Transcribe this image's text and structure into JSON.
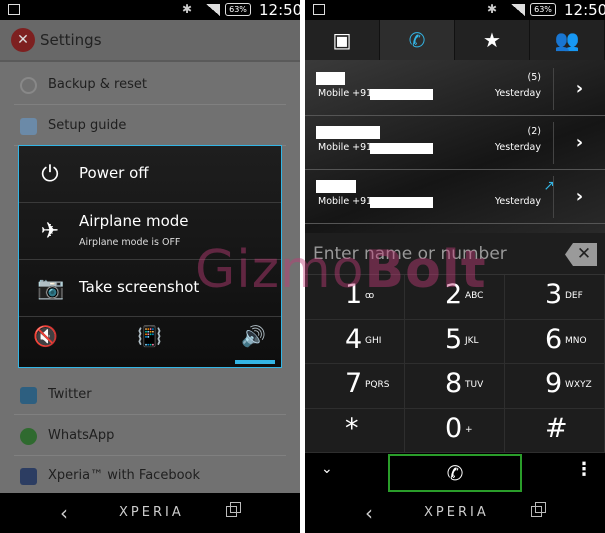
{
  "status": {
    "battery": "63%",
    "time": "12:50"
  },
  "settings": {
    "title": "Settings",
    "items": [
      {
        "label": "Backup & reset"
      },
      {
        "label": "Setup guide"
      },
      {
        "label": "Twitter"
      },
      {
        "label": "WhatsApp"
      },
      {
        "label": "Xperia™ with Facebook"
      }
    ]
  },
  "power_menu": {
    "power_off": "Power off",
    "airplane": "Airplane mode",
    "airplane_status": "Airplane mode is OFF",
    "screenshot": "Take screenshot",
    "sound_mode_selected": "sound-on"
  },
  "nav": {
    "brand": "XPERIA"
  },
  "dialer": {
    "tabs": [
      {
        "icon": "contacts-icon"
      },
      {
        "icon": "phone-icon",
        "selected": true
      },
      {
        "icon": "star-icon"
      },
      {
        "icon": "groups-icon"
      }
    ],
    "calls": [
      {
        "number_prefix": "Mobile +91",
        "count": "(5)",
        "date": "Yesterday"
      },
      {
        "number_prefix": "Mobile +91",
        "count": "(2)",
        "date": "Yesterday"
      },
      {
        "number_prefix": "Mobile +91",
        "date": "Yesterday",
        "type": "outgoing"
      }
    ],
    "input_placeholder": "Enter name or number",
    "keys": [
      {
        "d": "1",
        "l": "ꝏ"
      },
      {
        "d": "2",
        "l": "ABC"
      },
      {
        "d": "3",
        "l": "DEF"
      },
      {
        "d": "4",
        "l": "GHI"
      },
      {
        "d": "5",
        "l": "JKL"
      },
      {
        "d": "6",
        "l": "MNO"
      },
      {
        "d": "7",
        "l": "PQRS"
      },
      {
        "d": "8",
        "l": "TUV"
      },
      {
        "d": "9",
        "l": "WXYZ"
      },
      {
        "d": "*",
        "l": ""
      },
      {
        "d": "0",
        "l": "+"
      },
      {
        "d": "#",
        "l": ""
      }
    ]
  },
  "watermark": {
    "a": "Gizmo",
    "b": "Bolt"
  },
  "colors": {
    "accent": "#33b5e5",
    "call_border": "#2a9d2a",
    "watermark": "#be3c78"
  }
}
